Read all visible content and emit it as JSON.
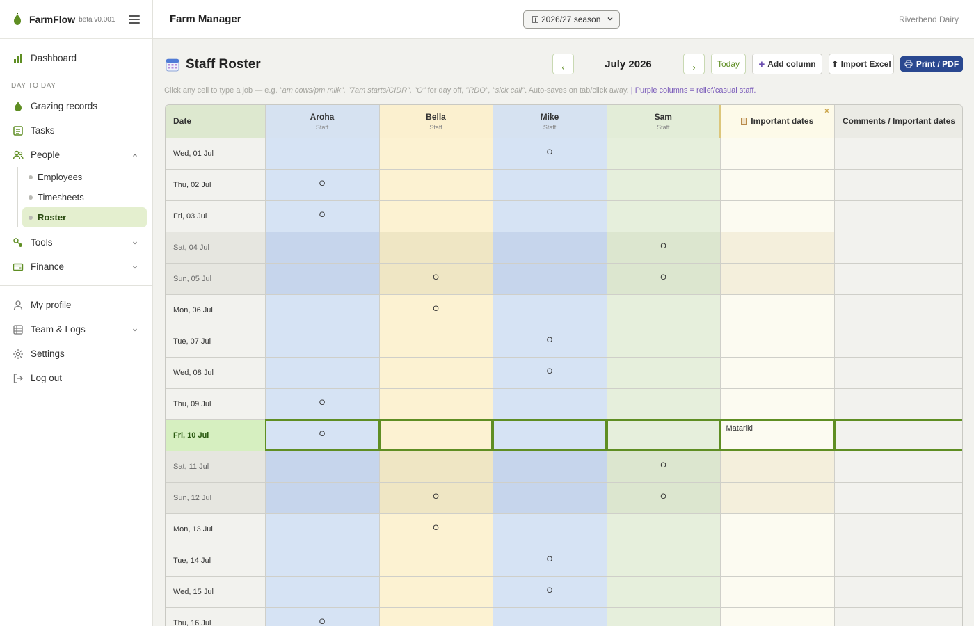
{
  "brand": {
    "name": "FarmFlow",
    "version": "beta v0.001"
  },
  "sidebar": {
    "dashboard": "Dashboard",
    "section_day_to_day": "DAY TO DAY",
    "grazing": "Grazing records",
    "tasks": "Tasks",
    "people": "People",
    "people_sub": [
      "Employees",
      "Timesheets",
      "Roster"
    ],
    "tools": "Tools",
    "finance": "Finance",
    "my_profile": "My profile",
    "team_logs": "Team & Logs",
    "settings": "Settings",
    "logout": "Log out"
  },
  "header": {
    "title": "Farm Manager",
    "season_select": "2026/27 season",
    "farm_name": "Riverbend Dairy"
  },
  "page": {
    "title": "Staff Roster",
    "month": "July 2026",
    "prev": "‹",
    "next": "›",
    "today": "Today",
    "add_column": "Add column",
    "import_excel": "⬆ Import Excel",
    "print_pdf": "Print / PDF",
    "hint_prefix": "Click any cell to type a job — e.g. ",
    "hint_examples": "\"am cows/pm milk\", \"7am starts/CIDR\", \"O\"",
    "hint_mid": " for day off, ",
    "hint_examples2": "\"RDO\", \"sick call\"",
    "hint_suffix": ". Auto-saves on tab/click away.",
    "hint_sep": " | ",
    "hint_purple": "Purple columns = relief/casual staff."
  },
  "roster": {
    "date_header": "Date",
    "columns": [
      {
        "name": "Aroha",
        "role": "Staff"
      },
      {
        "name": "Bella",
        "role": "Staff"
      },
      {
        "name": "Mike",
        "role": "Staff"
      },
      {
        "name": "Sam",
        "role": "Staff"
      }
    ],
    "important_header": "Important dates",
    "important_close": "×",
    "comments_header": "Comments / Important dates",
    "rows": [
      {
        "date": "Wed, 01 Jul",
        "weekend": false,
        "cells": [
          "",
          "",
          "O",
          ""
        ],
        "important": "",
        "comment": ""
      },
      {
        "date": "Thu, 02 Jul",
        "weekend": false,
        "cells": [
          "O",
          "",
          "",
          ""
        ],
        "important": "",
        "comment": ""
      },
      {
        "date": "Fri, 03 Jul",
        "weekend": false,
        "cells": [
          "O",
          "",
          "",
          ""
        ],
        "important": "",
        "comment": ""
      },
      {
        "date": "Sat, 04 Jul",
        "weekend": true,
        "cells": [
          "",
          "",
          "",
          "O"
        ],
        "important": "",
        "comment": ""
      },
      {
        "date": "Sun, 05 Jul",
        "weekend": true,
        "cells": [
          "",
          "O",
          "",
          "O"
        ],
        "important": "",
        "comment": ""
      },
      {
        "date": "Mon, 06 Jul",
        "weekend": false,
        "cells": [
          "",
          "O",
          "",
          ""
        ],
        "important": "",
        "comment": ""
      },
      {
        "date": "Tue, 07 Jul",
        "weekend": false,
        "cells": [
          "",
          "",
          "O",
          ""
        ],
        "important": "",
        "comment": ""
      },
      {
        "date": "Wed, 08 Jul",
        "weekend": false,
        "cells": [
          "",
          "",
          "O",
          ""
        ],
        "important": "",
        "comment": ""
      },
      {
        "date": "Thu, 09 Jul",
        "weekend": false,
        "cells": [
          "O",
          "",
          "",
          ""
        ],
        "important": "",
        "comment": ""
      },
      {
        "date": "Fri, 10 Jul",
        "weekend": false,
        "today": true,
        "cells": [
          "O",
          "",
          "",
          ""
        ],
        "important": "Matariki",
        "comment": ""
      },
      {
        "date": "Sat, 11 Jul",
        "weekend": true,
        "cells": [
          "",
          "",
          "",
          "O"
        ],
        "important": "",
        "comment": ""
      },
      {
        "date": "Sun, 12 Jul",
        "weekend": true,
        "cells": [
          "",
          "O",
          "",
          "O"
        ],
        "important": "",
        "comment": ""
      },
      {
        "date": "Mon, 13 Jul",
        "weekend": false,
        "cells": [
          "",
          "O",
          "",
          ""
        ],
        "important": "",
        "comment": ""
      },
      {
        "date": "Tue, 14 Jul",
        "weekend": false,
        "cells": [
          "",
          "",
          "O",
          ""
        ],
        "important": "",
        "comment": ""
      },
      {
        "date": "Wed, 15 Jul",
        "weekend": false,
        "cells": [
          "",
          "",
          "O",
          ""
        ],
        "important": "",
        "comment": ""
      },
      {
        "date": "Thu, 16 Jul",
        "weekend": false,
        "cells": [
          "O",
          "",
          "",
          ""
        ],
        "important": "",
        "comment": ""
      }
    ]
  },
  "colors": {
    "accent_green": "#5f8e23",
    "print_button": "#2a4890",
    "relief_purple": "#7b5cba"
  }
}
